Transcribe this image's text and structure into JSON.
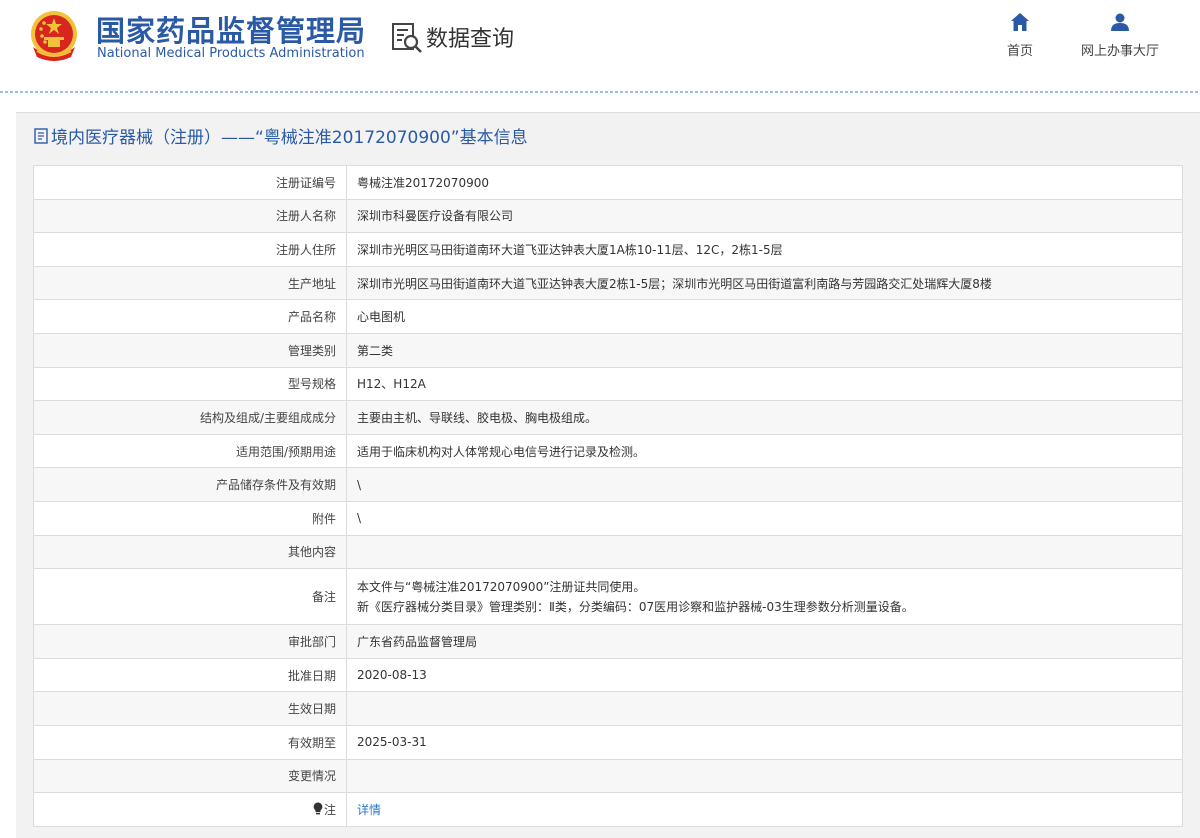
{
  "header": {
    "agency_cn": "国家药品监督管理局",
    "agency_en": "National Medical Products Administration",
    "query_label": "数据查询",
    "nav": [
      {
        "label": "首页",
        "icon": "home-icon"
      },
      {
        "label": "网上办事大厅",
        "icon": "user-icon"
      }
    ]
  },
  "panel": {
    "title": "境内医疗器械（注册）——“粤械注准20172070900”基本信息",
    "title_icon": "document-icon"
  },
  "rows": [
    {
      "key": "注册证编号",
      "value": "粤械注准20172070900"
    },
    {
      "key": "注册人名称",
      "value": "深圳市科曼医疗设备有限公司"
    },
    {
      "key": "注册人住所",
      "value": "深圳市光明区马田街道南环大道飞亚达钟表大厦1A栋10-11层、12C，2栋1-5层"
    },
    {
      "key": "生产地址",
      "value": "深圳市光明区马田街道南环大道飞亚达钟表大厦2栋1-5层；深圳市光明区马田街道富利南路与芳园路交汇处瑞辉大厦8楼"
    },
    {
      "key": "产品名称",
      "value": "心电图机"
    },
    {
      "key": "管理类别",
      "value": "第二类"
    },
    {
      "key": "型号规格",
      "value": "H12、H12A"
    },
    {
      "key": "结构及组成/主要组成成分",
      "value": "主要由主机、导联线、胶电极、胸电极组成。"
    },
    {
      "key": "适用范围/预期用途",
      "value": "适用于临床机构对人体常规心电信号进行记录及检测。"
    },
    {
      "key": "产品储存条件及有效期",
      "value": "\\"
    },
    {
      "key": "附件",
      "value": "\\"
    },
    {
      "key": "其他内容",
      "value": ""
    },
    {
      "key": "备注",
      "value": "本文件与“粤械注准20172070900”注册证共同使用。",
      "value2": "新《医疗器械分类目录》管理类别：Ⅱ类，分类编码：07医用诊察和监护器械-03生理参数分析测量设备。"
    },
    {
      "key": "审批部门",
      "value": "广东省药品监督管理局"
    },
    {
      "key": "批准日期",
      "value": "2020-08-13"
    },
    {
      "key": "生效日期",
      "value": ""
    },
    {
      "key": "有效期至",
      "value": "2025-03-31"
    },
    {
      "key": "变更情况",
      "value": ""
    },
    {
      "key": "注",
      "value": "详情",
      "key_icon": "lightbulb-icon"
    }
  ],
  "colors": {
    "brand": "#2a5aa6",
    "link": "#2a7ac9",
    "emblem_red": "#d7261d",
    "emblem_gold": "#f3c13a"
  }
}
